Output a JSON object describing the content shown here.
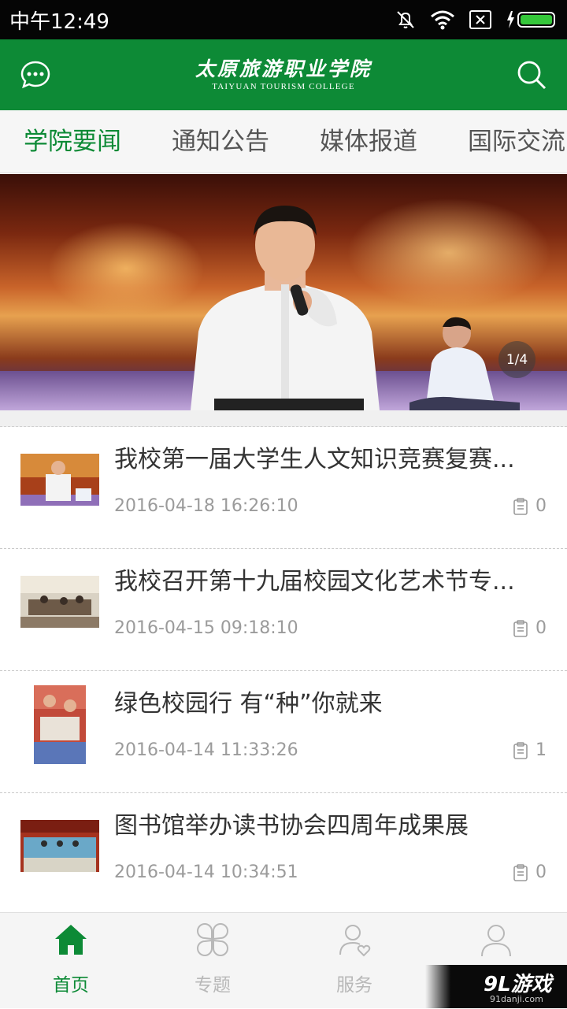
{
  "status_bar": {
    "time": "中午12:49"
  },
  "header": {
    "logo_cn": "太原旅游职业学院",
    "logo_en": "TAIYUAN TOURISM COLLEGE"
  },
  "tabs": [
    {
      "label": "学院要闻",
      "active": true
    },
    {
      "label": "通知公告",
      "active": false
    },
    {
      "label": "媒体报道",
      "active": false
    },
    {
      "label": "国际交流",
      "active": false
    }
  ],
  "banner": {
    "counter": "1/4"
  },
  "news": [
    {
      "title": "我校第一届大学生人文知识竞赛复赛...",
      "date": "2016-04-18 16:26:10",
      "comments": "0"
    },
    {
      "title": "我校召开第十九届校园文化艺术节专...",
      "date": "2016-04-15 09:18:10",
      "comments": "0"
    },
    {
      "title": "绿色校园行 有“种”你就来",
      "date": "2016-04-14 11:33:26",
      "comments": "1"
    },
    {
      "title": "图书馆举办读书协会四周年成果展",
      "date": "2016-04-14 10:34:51",
      "comments": "0"
    }
  ],
  "bottom_nav": [
    {
      "label": "首页",
      "icon": "home-icon",
      "active": true
    },
    {
      "label": "专题",
      "icon": "clover-icon",
      "active": false
    },
    {
      "label": "服务",
      "icon": "user-heart-icon",
      "active": false
    },
    {
      "label": "我的",
      "icon": "user-icon",
      "active": false
    }
  ],
  "watermark": {
    "logo": "9L游戏",
    "sub": "91danji.com"
  },
  "colors": {
    "brand_green": "#0d8a36",
    "inactive_gray": "#b8b8b8"
  }
}
